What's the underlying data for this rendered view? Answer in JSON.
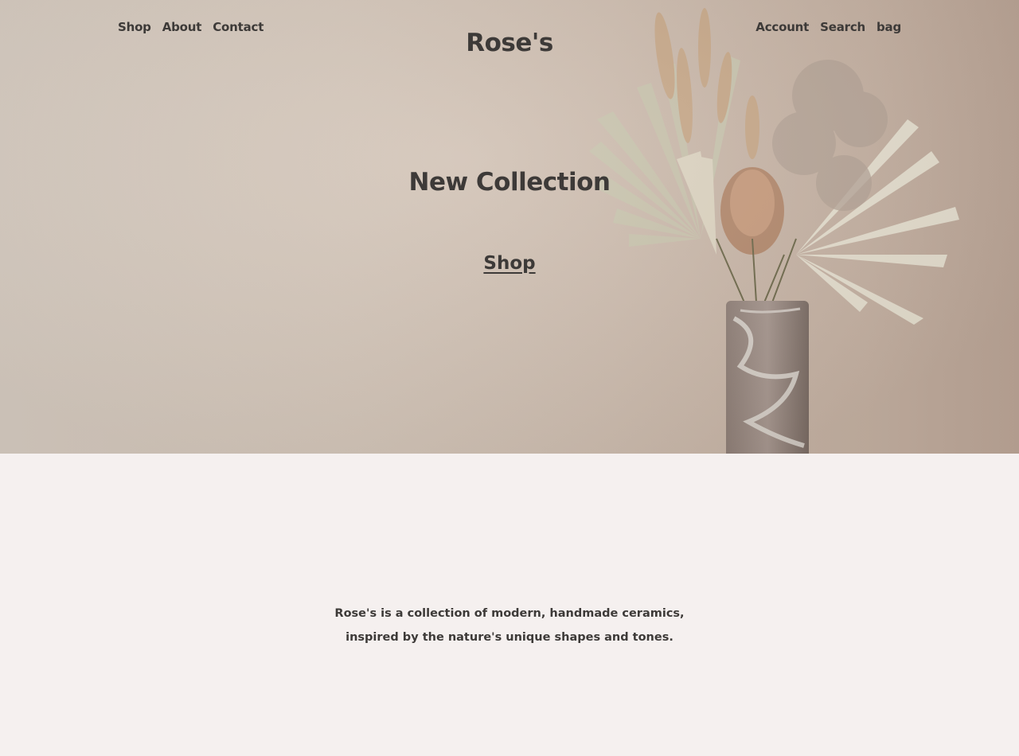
{
  "header": {
    "nav_left": [
      "Shop",
      "About",
      "Contact"
    ],
    "brand": "Rose's",
    "nav_right": [
      "Account",
      "Search",
      "bag"
    ]
  },
  "hero": {
    "headline": "New Collection",
    "cta_label": "Shop",
    "image_alt": "dried-flower-bouquet-in-marble-vase"
  },
  "about": {
    "text": "Rose's is a collection of modern, handmade ceramics, inspired by the nature's unique shapes and tones."
  },
  "colors": {
    "text": "#3d3a38",
    "hero_background": "#d3c5b8",
    "page_background": "#f5f0ef"
  }
}
